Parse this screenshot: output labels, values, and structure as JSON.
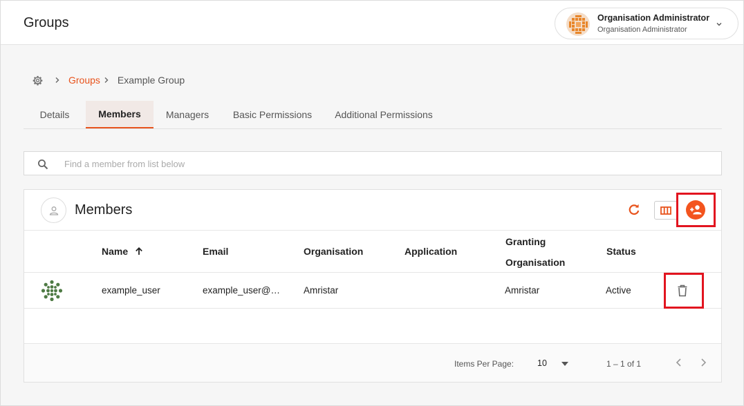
{
  "header": {
    "title": "Groups",
    "user": {
      "name": "Organisation Administrator",
      "role": "Organisation Administrator"
    }
  },
  "breadcrumb": {
    "parent": "Groups",
    "current": "Example Group"
  },
  "tabs": [
    {
      "label": "Details"
    },
    {
      "label": "Members",
      "active": true
    },
    {
      "label": "Managers"
    },
    {
      "label": "Basic Permissions"
    },
    {
      "label": "Additional Permissions"
    }
  ],
  "search": {
    "placeholder": "Find a member from list below",
    "value": ""
  },
  "members_card": {
    "title": "Members",
    "columns": {
      "name": "Name",
      "email": "Email",
      "organisation": "Organisation",
      "application": "Application",
      "granting_line1": "Granting",
      "granting_line2": "Organisation",
      "status": "Status"
    },
    "rows": [
      {
        "name": "example_user",
        "email": "example_user@…",
        "organisation": "Amristar",
        "application": "",
        "granting_organisation": "Amristar",
        "status": "Active"
      }
    ]
  },
  "pagination": {
    "items_per_page_label": "Items Per Page:",
    "items_per_page": "10",
    "range": "1 – 1 of 1"
  },
  "colors": {
    "accent": "#e8531c",
    "highlight": "#e2141f",
    "avatar_green": "#4e7a44"
  }
}
